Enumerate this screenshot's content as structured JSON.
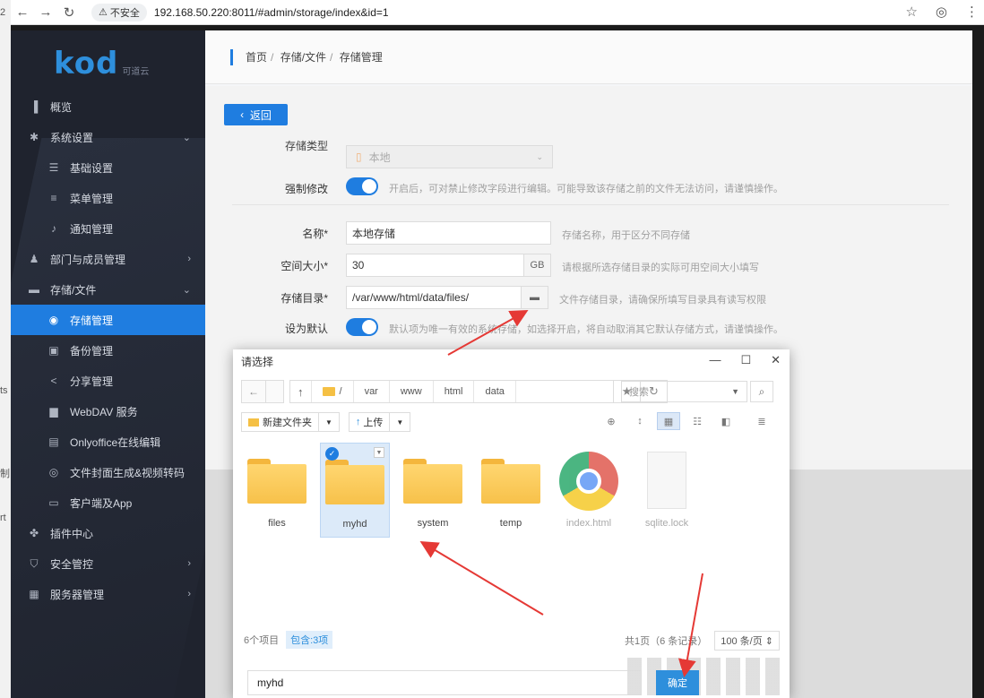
{
  "edge": [
    "2",
    "ts",
    "制",
    "rt"
  ],
  "browser": {
    "url": "192.168.50.220:8011/#admin/storage/index&id=1",
    "insecure": "不安全"
  },
  "sidebar": {
    "logo": "kod",
    "logo_sub": "可道云",
    "items": [
      {
        "label": "概览"
      },
      {
        "label": "系统设置"
      },
      {
        "label": "基础设置"
      },
      {
        "label": "菜单管理"
      },
      {
        "label": "通知管理"
      },
      {
        "label": "部门与成员管理"
      },
      {
        "label": "存储/文件"
      },
      {
        "label": "存储管理"
      },
      {
        "label": "备份管理"
      },
      {
        "label": "分享管理"
      },
      {
        "label": "WebDAV 服务"
      },
      {
        "label": "Onlyoffice在线编辑"
      },
      {
        "label": "文件封面生成&视频转码"
      },
      {
        "label": "客户端及App"
      },
      {
        "label": "插件中心"
      },
      {
        "label": "安全管控"
      },
      {
        "label": "服务器管理"
      }
    ]
  },
  "breadcrumb": {
    "home": "首页",
    "section": "存储/文件",
    "page": "存储管理"
  },
  "form": {
    "back": "返回",
    "storage_type_label": "存储类型",
    "storage_type_value": "本地",
    "force_label": "强制修改",
    "force_hint": "开启后，可对禁止修改字段进行编辑。可能导致该存储之前的文件无法访问，请谨慎操作。",
    "name_label": "名称",
    "name_value": "本地存储",
    "name_hint": "存储名称，用于区分不同存储",
    "size_label": "空间大小",
    "size_value": "30",
    "size_unit": "GB",
    "size_hint": "请根据所选存储目录的实际可用空间大小填写",
    "dir_label": "存储目录",
    "dir_value": "/var/www/html/data/files/",
    "dir_hint": "文件存储目录，请确保所填写目录具有读写权限",
    "default_label": "设为默认",
    "default_hint": "默认项为唯一有效的系统存储，如选择开启，将自动取消其它默认存储方式，请谨慎操作。",
    "required_mark": "*"
  },
  "dialog": {
    "title": "请选择",
    "path": [
      "/",
      "var",
      "www",
      "html",
      "data"
    ],
    "search_placeholder": "搜索",
    "new_folder": "新建文件夹",
    "upload": "上传",
    "files": [
      {
        "name": "files"
      },
      {
        "name": "myhd"
      },
      {
        "name": "system"
      },
      {
        "name": "temp"
      },
      {
        "name": "index.html"
      },
      {
        "name": "sqlite.lock"
      }
    ],
    "count": "6个项目",
    "contains": "包含:3项",
    "page_info": "共1页（6 条记录）",
    "per_page": "100 条/页",
    "filename": "myhd",
    "confirm": "确定"
  },
  "colors": {
    "accent": "#1f7de0",
    "arrow": "#e53935",
    "sidebar_bg": "#1f232e"
  }
}
